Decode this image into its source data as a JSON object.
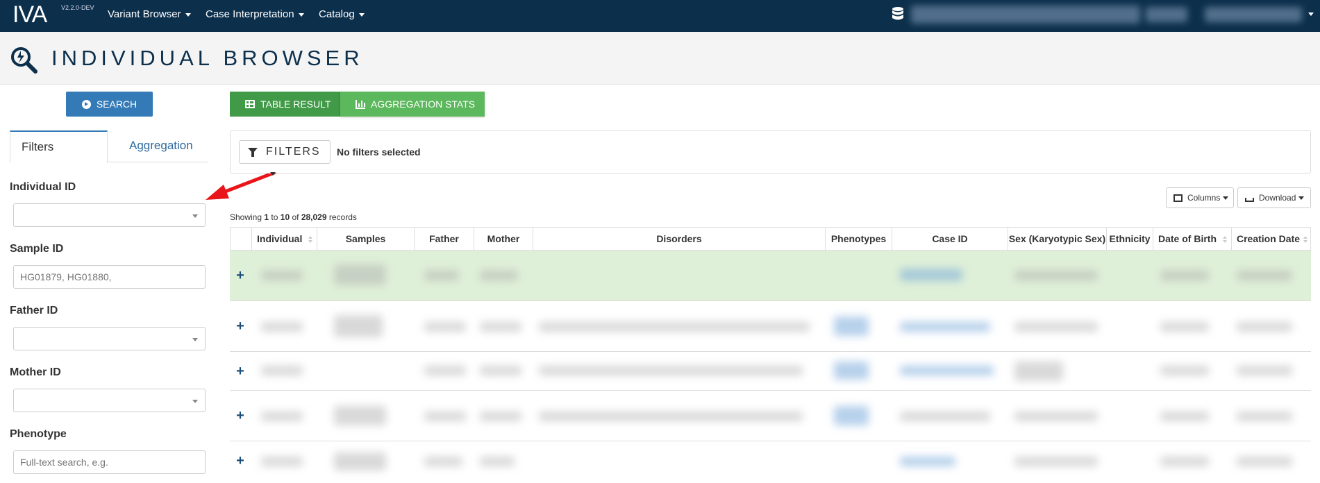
{
  "app": {
    "logo": "IVA",
    "version": "V2.2.0-DEV"
  },
  "nav": {
    "items": [
      {
        "label": "Variant Browser"
      },
      {
        "label": "Case Interpretation"
      },
      {
        "label": "Catalog"
      }
    ]
  },
  "page": {
    "title": "INDIVIDUAL BROWSER"
  },
  "sidebar": {
    "search_label": "SEARCH",
    "tabs": [
      {
        "label": "Filters",
        "active": true
      },
      {
        "label": "Aggregation",
        "active": false
      }
    ],
    "fields": [
      {
        "label": "Individual ID",
        "type": "select",
        "value": ""
      },
      {
        "label": "Sample ID",
        "type": "input",
        "placeholder": "HG01879, HG01880,"
      },
      {
        "label": "Father ID",
        "type": "select",
        "value": ""
      },
      {
        "label": "Mother ID",
        "type": "select",
        "value": ""
      },
      {
        "label": "Phenotype",
        "type": "input",
        "placeholder": "Full-text search, e.g."
      }
    ]
  },
  "results": {
    "view_tabs": [
      {
        "label": "TABLE RESULT",
        "icon": "table-icon"
      },
      {
        "label": "AGGREGATION STATS",
        "icon": "chart-icon"
      }
    ],
    "filters_label": "FILTERS",
    "no_filters": "No filters selected",
    "columns_label": "Columns",
    "download_label": "Download",
    "showing": {
      "prefix": "Showing",
      "from": "1",
      "to_word": "to",
      "to": "10",
      "of_word": "of",
      "total": "28,029",
      "suffix": "records"
    },
    "columns": [
      {
        "label": "Individual",
        "sortable": true
      },
      {
        "label": "Samples",
        "sortable": false
      },
      {
        "label": "Father",
        "sortable": false
      },
      {
        "label": "Mother",
        "sortable": false
      },
      {
        "label": "Disorders",
        "sortable": false
      },
      {
        "label": "Phenotypes",
        "sortable": false
      },
      {
        "label": "Case ID",
        "sortable": false
      },
      {
        "label": "Sex (Karyotypic Sex)",
        "sortable": false
      },
      {
        "label": "Ethnicity",
        "sortable": false
      },
      {
        "label": "Date of Birth",
        "sortable": true
      },
      {
        "label": "Creation Date",
        "sortable": true
      }
    ],
    "expand_symbol": "+"
  },
  "colors": {
    "navbar": "#0c2f4c",
    "primary": "#337ab7",
    "green_dark": "#419a48",
    "green": "#5cb85c",
    "highlight_row": "#dff0d8",
    "arrow": "#e8151b"
  }
}
